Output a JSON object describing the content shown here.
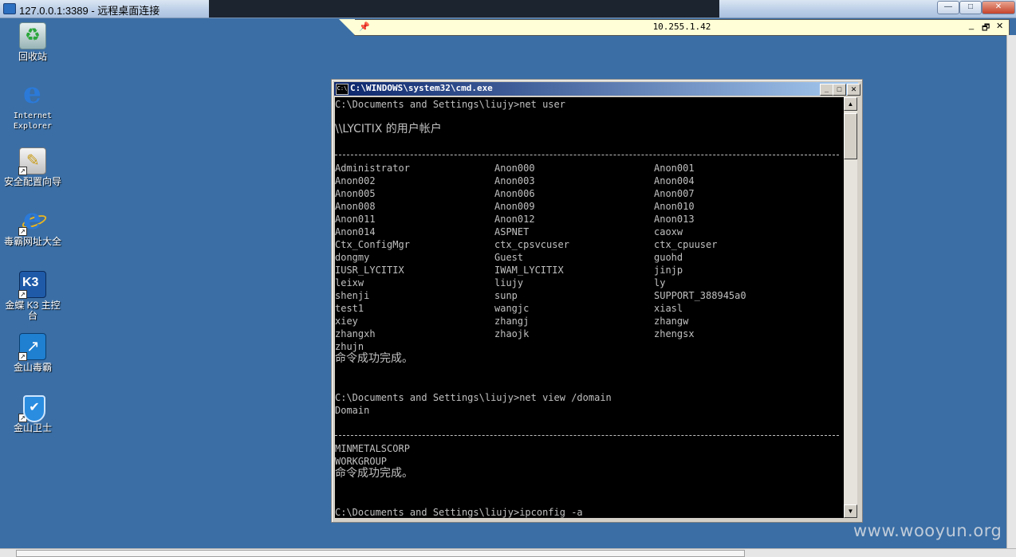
{
  "outer_window": {
    "title": "127.0.0.1:3389 - 远程桌面连接",
    "minimize": "—",
    "maximize": "□",
    "close": "✕"
  },
  "connection_bar": {
    "host": "10.255.1.42",
    "pin_icon": "pin-icon",
    "minimize": "_",
    "restore": "🗗",
    "close": "✕"
  },
  "desktop_icons": [
    {
      "label": "回收站",
      "icon": "recycle-bin-icon"
    },
    {
      "label": "Internet Explorer",
      "icon": "internet-explorer-icon"
    },
    {
      "label": "安全配置向导",
      "icon": "security-wizard-icon"
    },
    {
      "label": "毒霸网址大全",
      "icon": "ie-shortcut-icon"
    },
    {
      "label": "金蝶 K3 主控台",
      "icon": "k3-icon"
    },
    {
      "label": "金山毒霸",
      "icon": "kingsoft-antivirus-icon"
    },
    {
      "label": "金山卫士",
      "icon": "kingsoft-guard-icon"
    }
  ],
  "cmd_window": {
    "title": "C:\\WINDOWS\\system32\\cmd.exe",
    "icon_text": "C:\\",
    "minimize": "_",
    "maximize": "□",
    "close": "✕",
    "scroll_up": "▲",
    "scroll_down": "▼"
  },
  "console": {
    "prompt1": "C:\\Documents and Settings\\liujy>net user",
    "accounts_header": "\\\\LYCITIX 的用户帐户",
    "users": [
      [
        "Administrator",
        "Anon000",
        "Anon001"
      ],
      [
        "Anon002",
        "Anon003",
        "Anon004"
      ],
      [
        "Anon005",
        "Anon006",
        "Anon007"
      ],
      [
        "Anon008",
        "Anon009",
        "Anon010"
      ],
      [
        "Anon011",
        "Anon012",
        "Anon013"
      ],
      [
        "Anon014",
        "ASPNET",
        "caoxw"
      ],
      [
        "Ctx_ConfigMgr",
        "ctx_cpsvcuser",
        "ctx_cpuuser"
      ],
      [
        "dongmy",
        "Guest",
        "guohd"
      ],
      [
        "IUSR_LYCITIX",
        "IWAM_LYCITIX",
        "jinjp"
      ],
      [
        "leixw",
        "liujy",
        "ly"
      ],
      [
        "shenji",
        "sunp",
        "SUPPORT_388945a0"
      ],
      [
        "test1",
        "wangjc",
        "xiasl"
      ],
      [
        "xiey",
        "zhangj",
        "zhangw"
      ],
      [
        "zhangxh",
        "zhaojk",
        "zhengsx"
      ],
      [
        "zhujn",
        "",
        ""
      ]
    ],
    "success1": "命令成功完成。",
    "prompt2": "C:\\Documents and Settings\\liujy>net view /domain",
    "domain_header": "Domain",
    "domains": [
      "MINMETALSCORP",
      "WORKGROUP"
    ],
    "success2": "命令成功完成。",
    "prompt3": "C:\\Documents and Settings\\liujy>ipconfig -a"
  },
  "watermark": "www.wooyun.org"
}
